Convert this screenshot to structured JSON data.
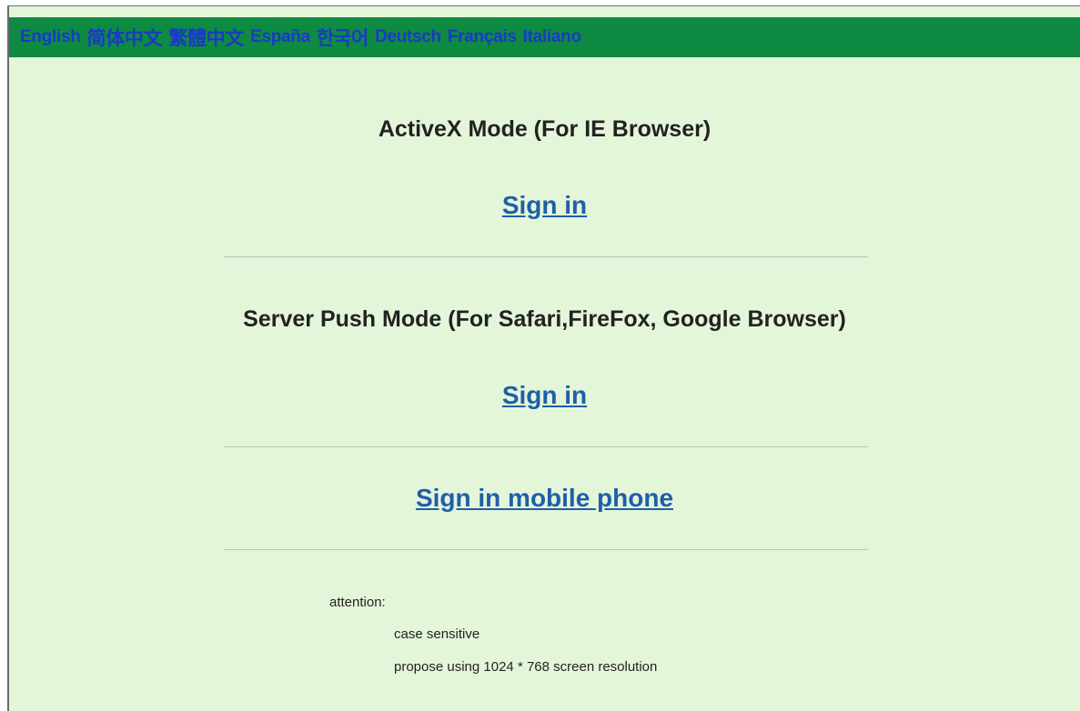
{
  "languages": [
    {
      "label": "English"
    },
    {
      "label": "简体中文"
    },
    {
      "label": "繁體中文"
    },
    {
      "label": "España"
    },
    {
      "label": "한국어"
    },
    {
      "label": "Deutsch"
    },
    {
      "label": "Français"
    },
    {
      "label": "Italiano"
    }
  ],
  "sections": {
    "activex": {
      "title": "ActiveX Mode (For IE Browser)",
      "signin_label": "Sign in"
    },
    "server_push": {
      "title": "Server Push Mode (For Safari,FireFox, Google Browser)",
      "signin_label": "Sign in"
    },
    "mobile": {
      "signin_label": "Sign in mobile phone"
    }
  },
  "attention": {
    "label": "attention:",
    "items": [
      "case sensitive",
      "propose using 1024 * 768 screen resolution"
    ]
  },
  "colors": {
    "page_background": "#e4f6da",
    "language_bar": "#0e8a43",
    "language_link": "#1a39c9",
    "signin_link": "#1f5fa8"
  }
}
